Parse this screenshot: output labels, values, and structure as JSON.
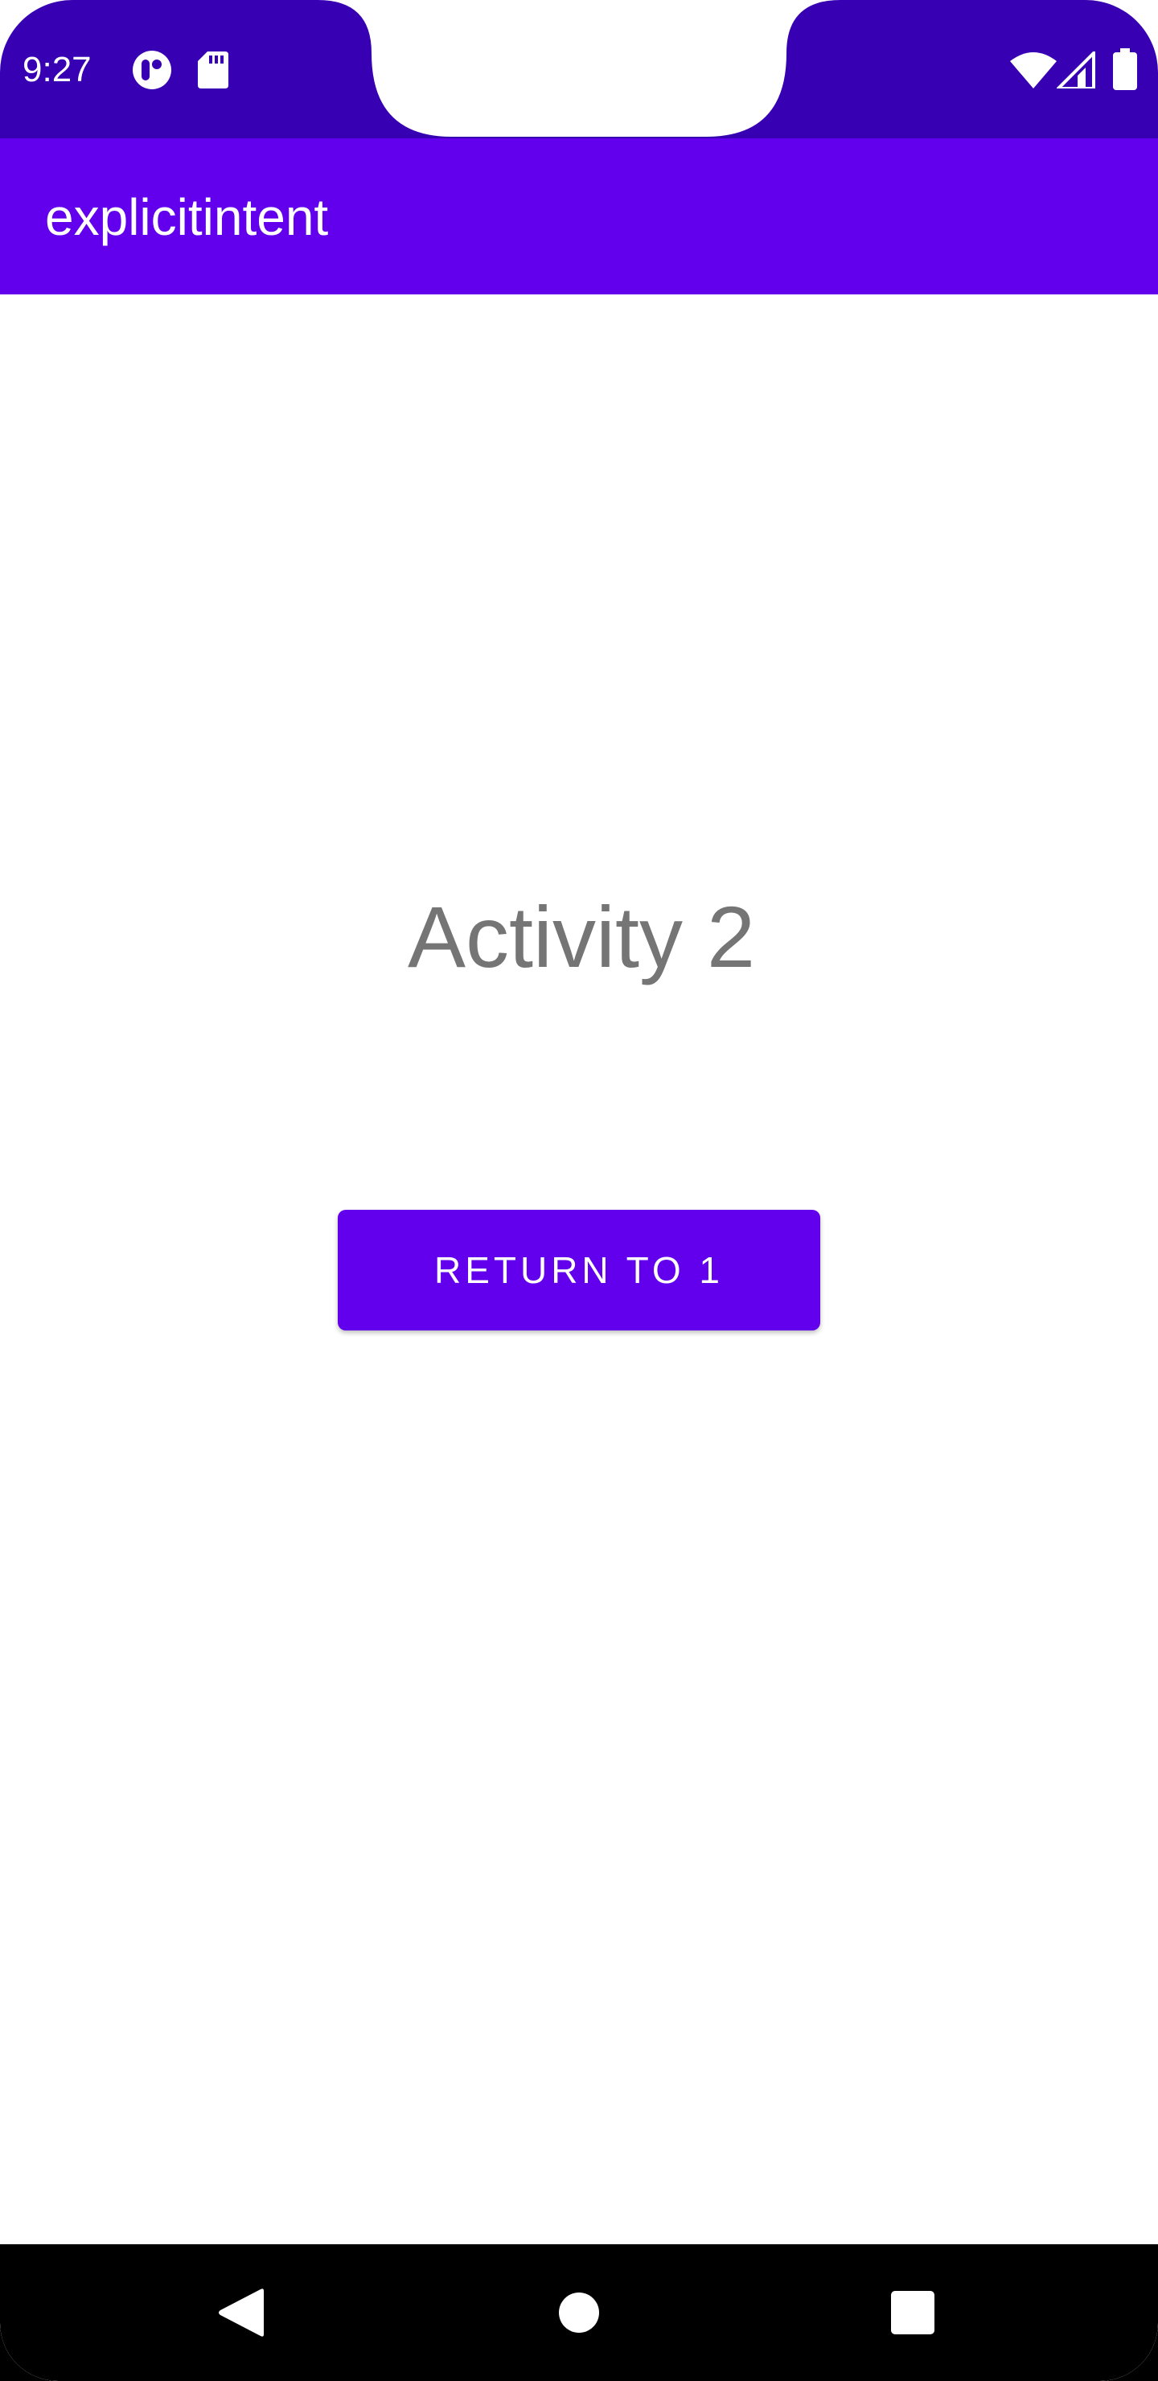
{
  "status_bar": {
    "time": "9:27",
    "icons": [
      "media-notification-icon",
      "sd-card-icon",
      "wifi-icon",
      "cell-signal-icon",
      "battery-icon"
    ],
    "background_color": "#3700B3"
  },
  "app_bar": {
    "title": "explicitintent",
    "background_color": "#6200EE"
  },
  "main": {
    "activity_label": "Activity 2",
    "return_button_label": "RETURN TO 1",
    "button_color": "#6200EE"
  },
  "nav_bar": {
    "buttons": [
      "back-icon",
      "home-icon",
      "recents-icon"
    ]
  }
}
